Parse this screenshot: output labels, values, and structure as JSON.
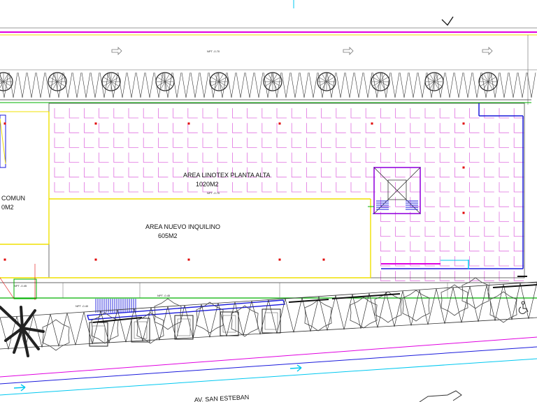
{
  "areas": {
    "linotex": {
      "name": "AREA LINOTEX PLANTA ALTA",
      "size": "1020M2"
    },
    "nuevo": {
      "name": "AREA NUEVO INQUILINO",
      "size": "605M2"
    },
    "comun": {
      "name": "COMUN",
      "size": "0M2"
    }
  },
  "street": {
    "name": "AV.   SAN  ESTEBAN"
  },
  "levels": [
    "NPT -0.70",
    "NPT -0.70",
    "NPT -0.45",
    "NPT -0.40",
    "NPT -0.45"
  ],
  "colors": {
    "magenta": "#e000e0",
    "yellow": "#f0e000",
    "blue": "#1a1adc",
    "green": "#00b000",
    "cyan": "#00c8f0",
    "red": "#e00000",
    "grid": "#e070e0",
    "line": "#333333"
  },
  "icons": [
    "north-arrow-icon",
    "accessibility-icon",
    "traffic-arrow-icon"
  ]
}
